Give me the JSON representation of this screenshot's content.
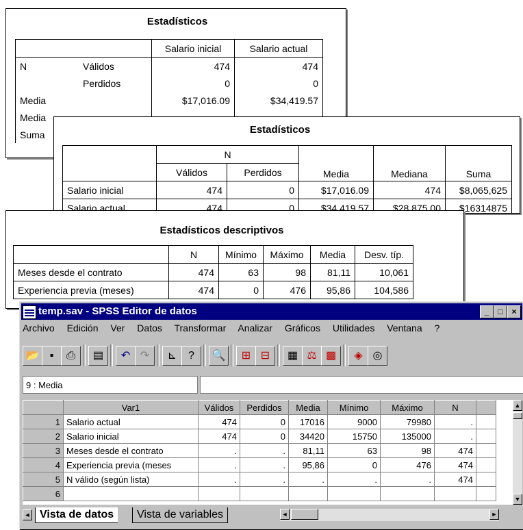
{
  "table1": {
    "title": "Estadísticos",
    "col_headers": [
      "Salario inicial",
      "Salario actual"
    ],
    "rows": [
      {
        "label": "N",
        "sub": "Válidos",
        "v1": "474",
        "v2": "474"
      },
      {
        "label": "",
        "sub": "Perdidos",
        "v1": "0",
        "v2": "0"
      },
      {
        "label": "Media",
        "sub": "",
        "v1": "$17,016.09",
        "v2": "$34,419.57"
      },
      {
        "label": "Media",
        "sub": "",
        "v1": "",
        "v2": ""
      },
      {
        "label": "Suma",
        "sub": "",
        "v1": "",
        "v2": ""
      }
    ]
  },
  "table2": {
    "title": "Estadísticos",
    "group_header": "N",
    "col_headers": [
      "Válidos",
      "Perdidos",
      "Media",
      "Mediana",
      "Suma"
    ],
    "rows": [
      {
        "label": "Salario inicial",
        "valid": "474",
        "missing": "0",
        "mean": "$17,016.09",
        "median": "474",
        "sum": "$8,065,625"
      },
      {
        "label": "Salario actual",
        "valid": "474",
        "missing": "0",
        "mean": "$34,419.57",
        "median": "$28,875.00",
        "sum": "$16314875"
      }
    ]
  },
  "table3": {
    "title": "Estadísticos descriptivos",
    "col_headers": [
      "N",
      "Mínimo",
      "Máximo",
      "Media",
      "Desv. típ."
    ],
    "rows": [
      {
        "label": "Meses desde el contrato",
        "n": "474",
        "min": "63",
        "max": "98",
        "mean": "81,11",
        "sd": "10,061"
      },
      {
        "label": "Experiencia previa (meses)",
        "n": "474",
        "min": "0",
        "max": "476",
        "mean": "95,86",
        "sd": "104,586"
      }
    ]
  },
  "window": {
    "title": "temp.sav - SPSS Editor de datos",
    "menu": [
      "Archivo",
      "Edición",
      "Ver",
      "Datos",
      "Transformar",
      "Analizar",
      "Gráficos",
      "Utilidades",
      "Ventana",
      "?"
    ],
    "cell_ref": "9 : Media",
    "columns": [
      "Var1",
      "Válidos",
      "Perdidos",
      "Media",
      "Mínimo",
      "Máximo",
      "N"
    ],
    "rows": [
      {
        "num": "1",
        "var1": "Salario actual",
        "valid": "474",
        "missing": "0",
        "mean": "17016",
        "min": "9000",
        "max": "79980",
        "n": "."
      },
      {
        "num": "2",
        "var1": "Salario inicial",
        "valid": "474",
        "missing": "0",
        "mean": "34420",
        "min": "15750",
        "max": "135000",
        "n": "."
      },
      {
        "num": "3",
        "var1": "Meses desde el contrato",
        "valid": ".",
        "missing": ".",
        "mean": "81,11",
        "min": "63",
        "max": "98",
        "n": "474"
      },
      {
        "num": "4",
        "var1": "Experiencia previa (meses",
        "valid": ".",
        "missing": ".",
        "mean": "95,86",
        "min": "0",
        "max": "476",
        "n": "474"
      },
      {
        "num": "5",
        "var1": "N válido (según lista)",
        "valid": ".",
        "missing": ".",
        "mean": ".",
        "min": ".",
        "max": ".",
        "n": "474"
      },
      {
        "num": "6",
        "var1": "",
        "valid": "",
        "missing": "",
        "mean": "",
        "min": "",
        "max": "",
        "n": ""
      }
    ],
    "tabs": [
      "Vista de datos",
      "Vista de variables"
    ]
  }
}
